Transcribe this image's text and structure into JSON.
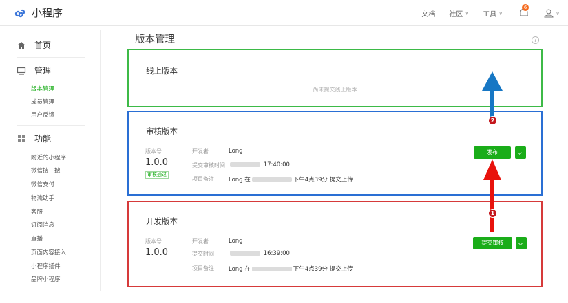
{
  "app": {
    "name": "小程序"
  },
  "topnav": {
    "docs": "文档",
    "community": "社区",
    "tools": "工具",
    "notification_count": "6"
  },
  "sidebar": {
    "home": "首页",
    "manage": "管理",
    "manage_items": [
      "版本管理",
      "成员管理",
      "用户反馈"
    ],
    "features": "功能",
    "feature_items": [
      "附近的小程序",
      "微信搜一搜",
      "微信支付",
      "物流助手",
      "客服",
      "订阅消息",
      "直播",
      "页面内容接入",
      "小程序插件",
      "品牌小程序"
    ]
  },
  "page": {
    "title": "版本管理"
  },
  "online": {
    "title": "线上版本",
    "empty": "尚未提交线上版本"
  },
  "review": {
    "title": "审核版本",
    "version_label": "版本号",
    "version": "1.0.0",
    "status_tag": "审核通过",
    "developer_label": "开发者",
    "developer": "Long",
    "submit_time_label": "提交审核时间",
    "submit_time": "17:40:00",
    "note_label": "项目备注",
    "note_prefix": "Long 在",
    "note_suffix": "下午4点39分 提交上传",
    "publish_button": "发布"
  },
  "dev": {
    "title": "开发版本",
    "version_label": "版本号",
    "version": "1.0.0",
    "developer_label": "开发者",
    "developer": "Long",
    "submit_time_label": "提交时间",
    "submit_time": "16:39:00",
    "note_label": "项目备注",
    "note_prefix": "Long 在",
    "note_suffix": "下午4点39分 提交上传",
    "submit_review_button": "提交审核"
  },
  "annotations": {
    "step1": "1",
    "step2": "2"
  },
  "colors": {
    "online_border": "#3dba47",
    "review_border": "#2a6fd4",
    "dev_border": "#d63a3a",
    "primary_button": "#1aad19"
  }
}
